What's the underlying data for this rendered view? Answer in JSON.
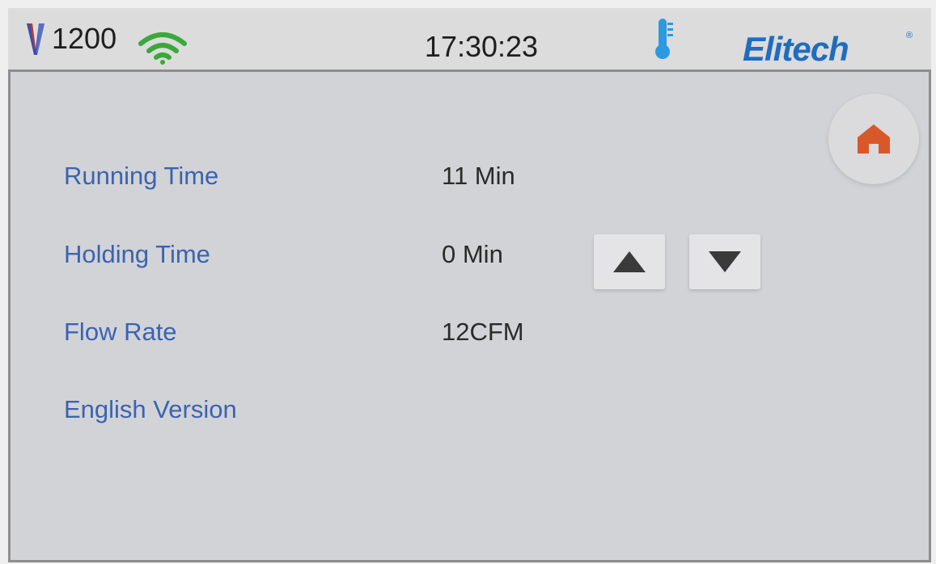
{
  "status_bar": {
    "model_label": "1200",
    "clock": "17:30:23",
    "brand": "Elitech",
    "brand_mark": "®",
    "icons": [
      "v-logo-icon",
      "wifi-icon",
      "thermometer-icon"
    ]
  },
  "home_button": {
    "icon": "home-icon"
  },
  "settings": [
    {
      "label": "Running Time",
      "value": "11 Min"
    },
    {
      "label": "Holding Time",
      "value": "0 Min"
    },
    {
      "label": "Flow Rate",
      "value": "12CFM"
    },
    {
      "label": "English Version",
      "value": ""
    }
  ],
  "adjust_buttons": {
    "up_icon": "triangle-up-icon",
    "down_icon": "triangle-down-icon"
  },
  "colors": {
    "label": "#3b63b2",
    "value": "#2a2a2a",
    "brand": "#1f6cc0",
    "home_icon": "#d9582a",
    "wifi": "#3aa83a",
    "panel": "#d2d3d6"
  }
}
